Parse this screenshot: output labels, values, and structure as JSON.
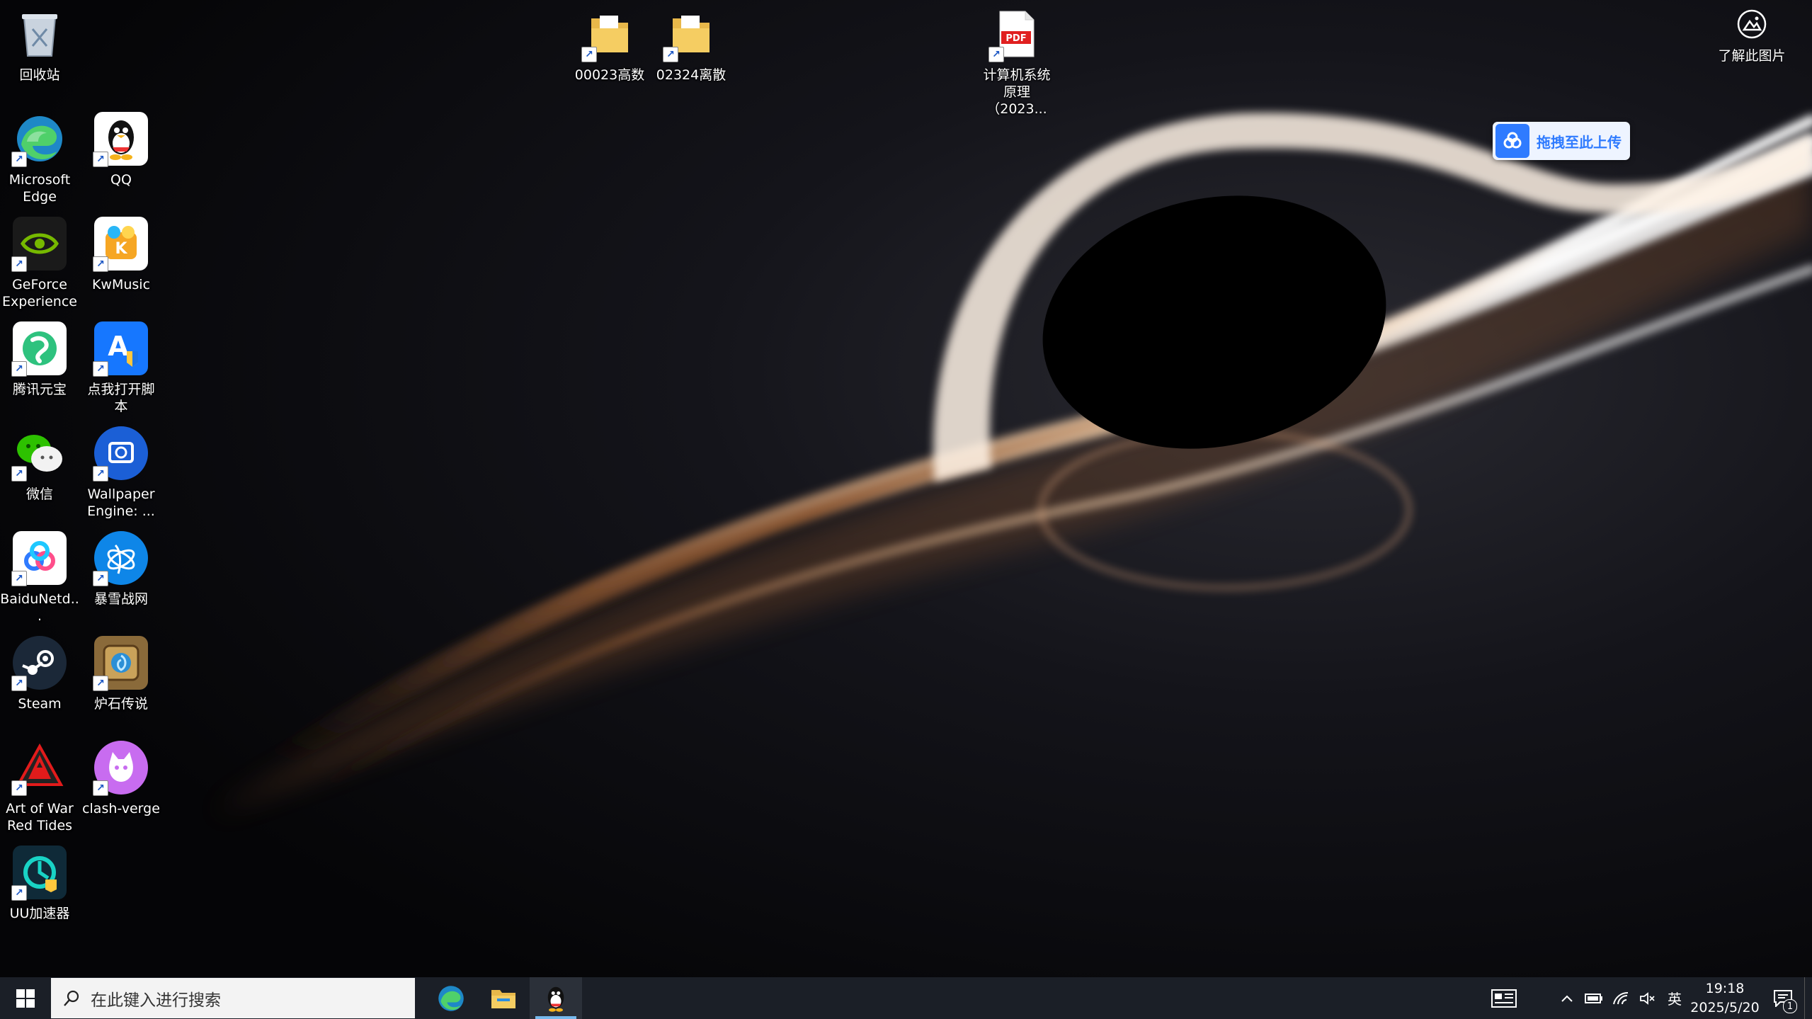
{
  "desktop": {
    "icons": [
      {
        "id": "recycle-bin",
        "label": "回收站"
      },
      {
        "id": "edge",
        "label": "Microsoft Edge"
      },
      {
        "id": "qq",
        "label": "QQ"
      },
      {
        "id": "geforce",
        "label": "GeForce Experience"
      },
      {
        "id": "kwmusic",
        "label": "KwMusic"
      },
      {
        "id": "yuanbao",
        "label": "腾讯元宝"
      },
      {
        "id": "script",
        "label": "点我打开脚本"
      },
      {
        "id": "wechat",
        "label": "微信"
      },
      {
        "id": "wallpaper-engine",
        "label": "Wallpaper Engine: ..."
      },
      {
        "id": "baidunetdisk",
        "label": "BaiduNetd..."
      },
      {
        "id": "battlenet",
        "label": "暴雪战网"
      },
      {
        "id": "steam",
        "label": "Steam"
      },
      {
        "id": "hearthstone",
        "label": "炉石传说"
      },
      {
        "id": "artofwar",
        "label": "Art of War Red Tides"
      },
      {
        "id": "clash-verge",
        "label": "clash-verge"
      },
      {
        "id": "uu",
        "label": "UU加速器"
      },
      {
        "id": "folder-00023",
        "label": "00023高数"
      },
      {
        "id": "folder-02324",
        "label": "02324离散"
      },
      {
        "id": "pdf",
        "label": "计算机系统原理（2023..."
      }
    ]
  },
  "baidu_upload": {
    "label": "拖拽至此上传"
  },
  "learn_picture": {
    "label": "了解此图片"
  },
  "taskbar": {
    "search_placeholder": "在此键入进行搜索",
    "apps": [
      {
        "id": "edge-icon",
        "active": false
      },
      {
        "id": "file-explorer-icon",
        "active": false
      },
      {
        "id": "qq-icon",
        "active": true
      }
    ],
    "tray": {
      "ime": "英",
      "time": "19:18",
      "date": "2025/5/20",
      "notification_count": "1"
    }
  },
  "colors": {
    "taskbar_bg": "#1b1f27",
    "accent": "#76b9ed",
    "baidu_blue": "#2f7bff"
  }
}
